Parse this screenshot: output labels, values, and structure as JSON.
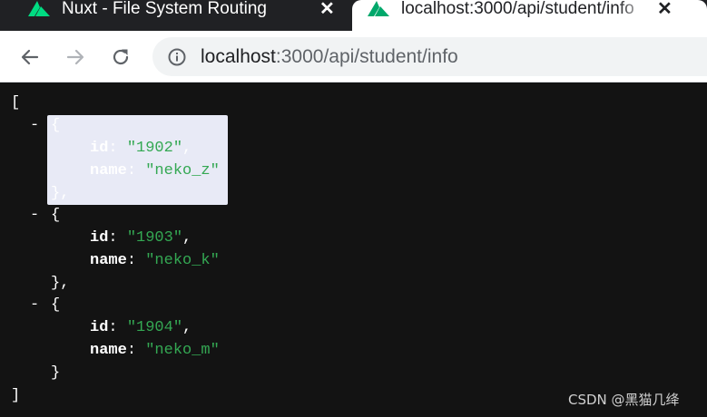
{
  "tabs": [
    {
      "title": "Nuxt - File System Routing",
      "icon": "nuxt-logo-icon",
      "active": false
    },
    {
      "title": "localhost:3000/api/student/info",
      "icon": "nuxt-logo-icon",
      "active": true
    }
  ],
  "tab_close_glyph": "✕",
  "toolbar": {
    "back_icon": "arrow-left-icon",
    "forward_icon": "arrow-right-icon",
    "reload_icon": "reload-icon",
    "site_info_icon": "info-icon"
  },
  "address": {
    "host": "localhost",
    "rest": ":3000/api/student/info"
  },
  "json_view": {
    "open_bracket": "[",
    "close_bracket": "]",
    "collapse_glyph": "-",
    "items": [
      {
        "id": "\"1902\"",
        "name": "\"neko_z\"",
        "selected": true
      },
      {
        "id": "\"1903\"",
        "name": "\"neko_k\"",
        "selected": false
      },
      {
        "id": "\"1904\"",
        "name": "\"neko_m\"",
        "selected": false
      }
    ],
    "key_id": "id",
    "key_name": "name"
  },
  "watermark": "CSDN @黑猫几绛",
  "colors": {
    "tab_strip": "#202124",
    "viewer_bg": "#131313",
    "string_value": "#34a853",
    "selection": "#e8eaf6"
  }
}
